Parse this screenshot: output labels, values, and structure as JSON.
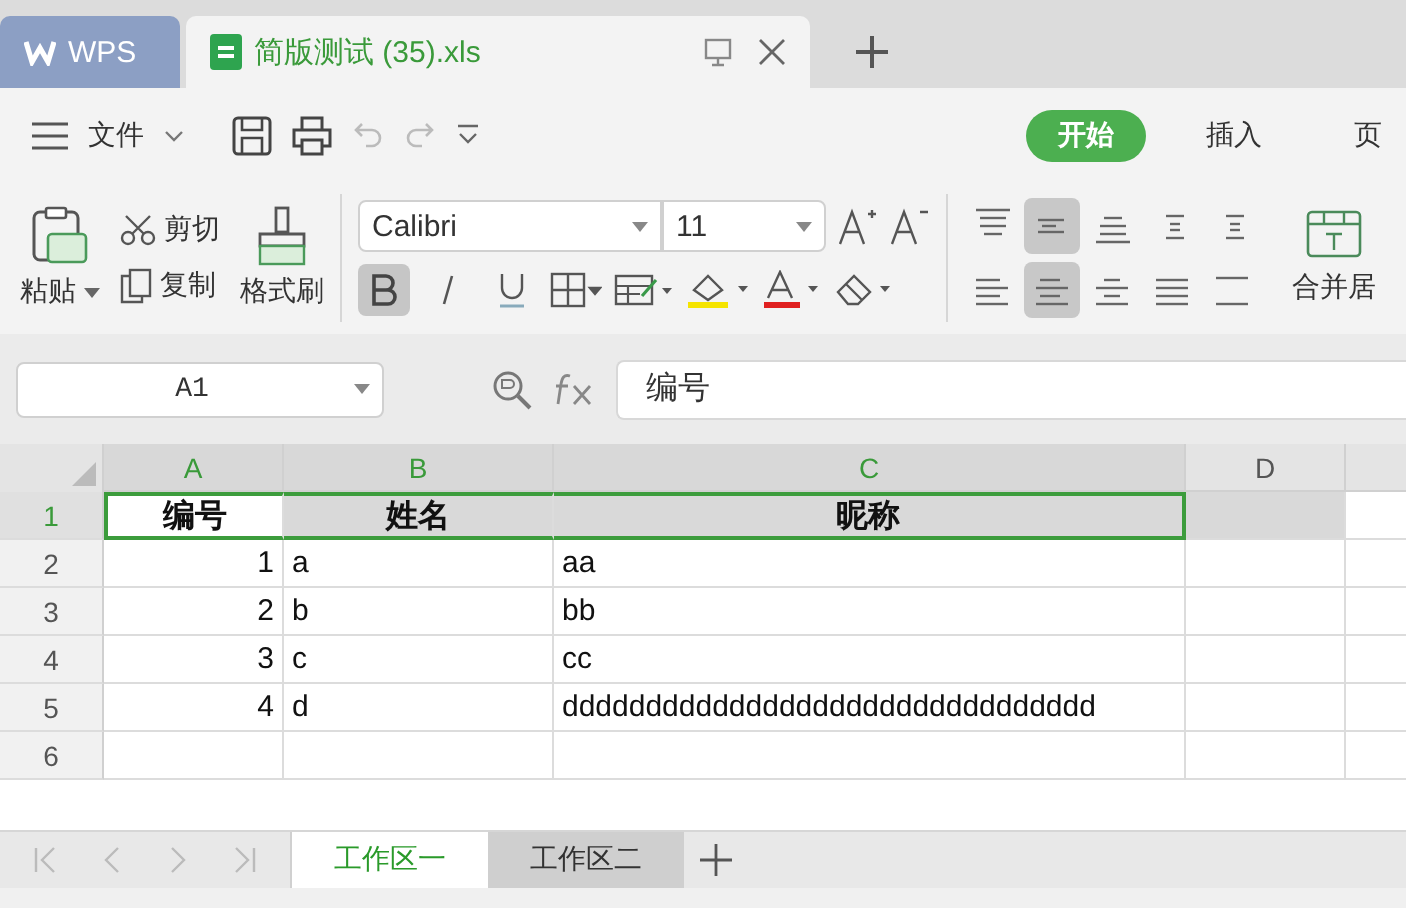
{
  "tabs": [
    {
      "kind": "home",
      "label": "WPS",
      "selected": false
    },
    {
      "kind": "document",
      "label": "简版测试 (35).xls",
      "selected": true
    }
  ],
  "menu": {
    "file_label": "文件"
  },
  "ribbon_tabs": [
    {
      "label": "开始",
      "selected": true
    },
    {
      "label": "插入",
      "selected": false
    },
    {
      "label": "页",
      "selected": false
    }
  ],
  "clipboard": {
    "paste": "粘贴",
    "cut": "剪切",
    "copy": "复制",
    "format_painter": "格式刷"
  },
  "font": {
    "name": "Calibri",
    "size": "11",
    "bold": true,
    "italic": false,
    "underline": false
  },
  "alignment": [
    {
      "kind": "top",
      "selected": false
    },
    {
      "kind": "middle",
      "selected": true
    },
    {
      "kind": "bottom",
      "selected": false
    },
    {
      "kind": "outdent",
      "selected": false
    },
    {
      "kind": "indent",
      "selected": false
    },
    {
      "kind": "left",
      "selected": false
    },
    {
      "kind": "center",
      "selected": true
    },
    {
      "kind": "right",
      "selected": false
    },
    {
      "kind": "justify",
      "selected": false
    },
    {
      "kind": "distribute",
      "selected": false
    }
  ],
  "merge_label": "合并居",
  "name_box": "A1",
  "formula": "编号",
  "sheet": {
    "columns": [
      {
        "label": "A",
        "kind": "number",
        "selected": true
      },
      {
        "label": "B",
        "kind": "text",
        "selected": true
      },
      {
        "label": "C",
        "kind": "text",
        "selected": true
      },
      {
        "label": "D",
        "kind": "text",
        "selected": false
      }
    ],
    "rows": [
      {
        "header": "1",
        "kind": "title",
        "selected": true,
        "cells": [
          "编号",
          "姓名",
          "昵称"
        ]
      },
      {
        "header": "2",
        "kind": "data",
        "selected": false,
        "cells": [
          "1",
          "a",
          "aa"
        ]
      },
      {
        "header": "3",
        "kind": "data",
        "selected": false,
        "cells": [
          "2",
          "b",
          "bb"
        ]
      },
      {
        "header": "4",
        "kind": "data",
        "selected": false,
        "cells": [
          "3",
          "c",
          "cc"
        ]
      },
      {
        "header": "5",
        "kind": "data",
        "selected": false,
        "cells": [
          "4",
          "d",
          "dddddddddddddddddddddddddddddddd"
        ]
      },
      {
        "header": "6",
        "kind": "data",
        "selected": false
      }
    ]
  },
  "sheet_tabs": [
    {
      "label": "工作区一",
      "selected": true
    },
    {
      "label": "工作区二",
      "selected": false
    }
  ]
}
